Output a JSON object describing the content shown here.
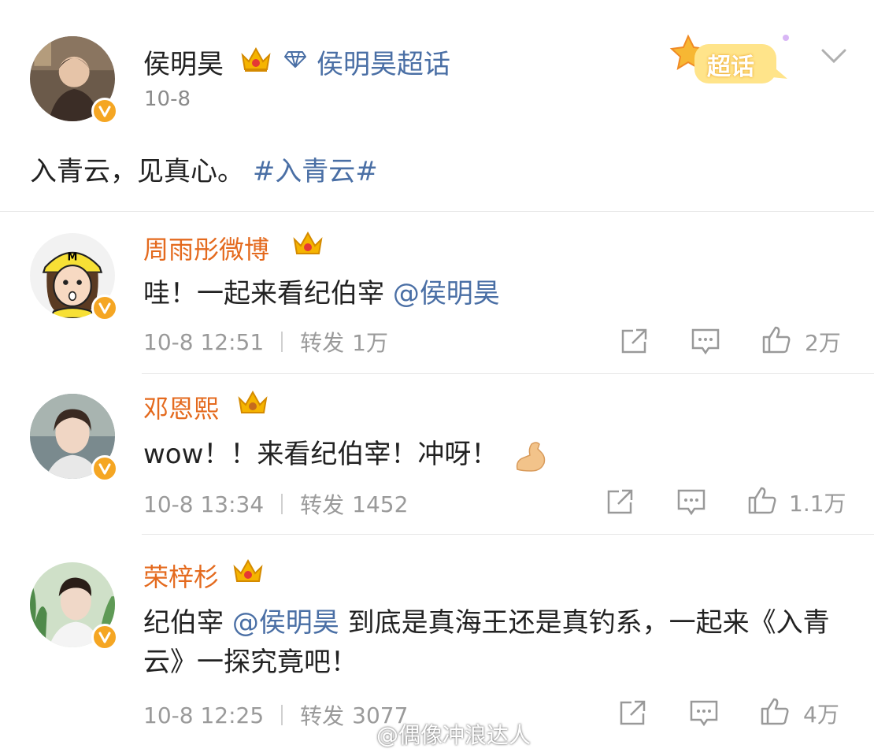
{
  "post": {
    "author": "侯明昊",
    "topic": "侯明昊超话",
    "date": "10-8",
    "text": "入青云，见真心。",
    "hashtag": "#入青云#",
    "super_badge": "超话"
  },
  "comments": [
    {
      "name": "周雨彤微博",
      "text_prefix": "哇！一起来看纪伯宰 ",
      "mention": "@侯明昊",
      "text_suffix": "",
      "time": "10-8 12:51",
      "repost_label": "转发",
      "repost_count": "1万",
      "likes": "2万"
    },
    {
      "name": "邓恩熙",
      "text_prefix": "wow！！来看纪伯宰！冲呀！",
      "mention": "",
      "text_suffix": "",
      "time": "10-8 13:34",
      "repost_label": "转发",
      "repost_count": "1452",
      "likes": "1.1万"
    },
    {
      "name": "荣梓杉",
      "text_prefix": "纪伯宰 ",
      "mention": "@侯明昊",
      "text_suffix": "  到底是真海王还是真钓系，一起来《入青云》一探究竟吧！",
      "time": "10-8 12:25",
      "repost_label": "转发",
      "repost_count": "3077",
      "likes": "4万"
    }
  ],
  "watermark": "@偶像冲浪达人",
  "icons": {
    "verified": "verified-v-icon",
    "crown": "crown-icon",
    "diamond": "diamond-icon",
    "share": "share-icon",
    "comment": "comment-icon",
    "like": "thumbs-up-icon",
    "chevron": "chevron-down-icon",
    "weibo": "weibo-logo-icon",
    "flexed_biceps": "flexed-biceps-emoji"
  },
  "colors": {
    "name_orange": "#e46a1e",
    "link_blue": "#4a6fa5",
    "meta_gray": "#9a9a9a",
    "verified_orange": "#f5a623"
  }
}
